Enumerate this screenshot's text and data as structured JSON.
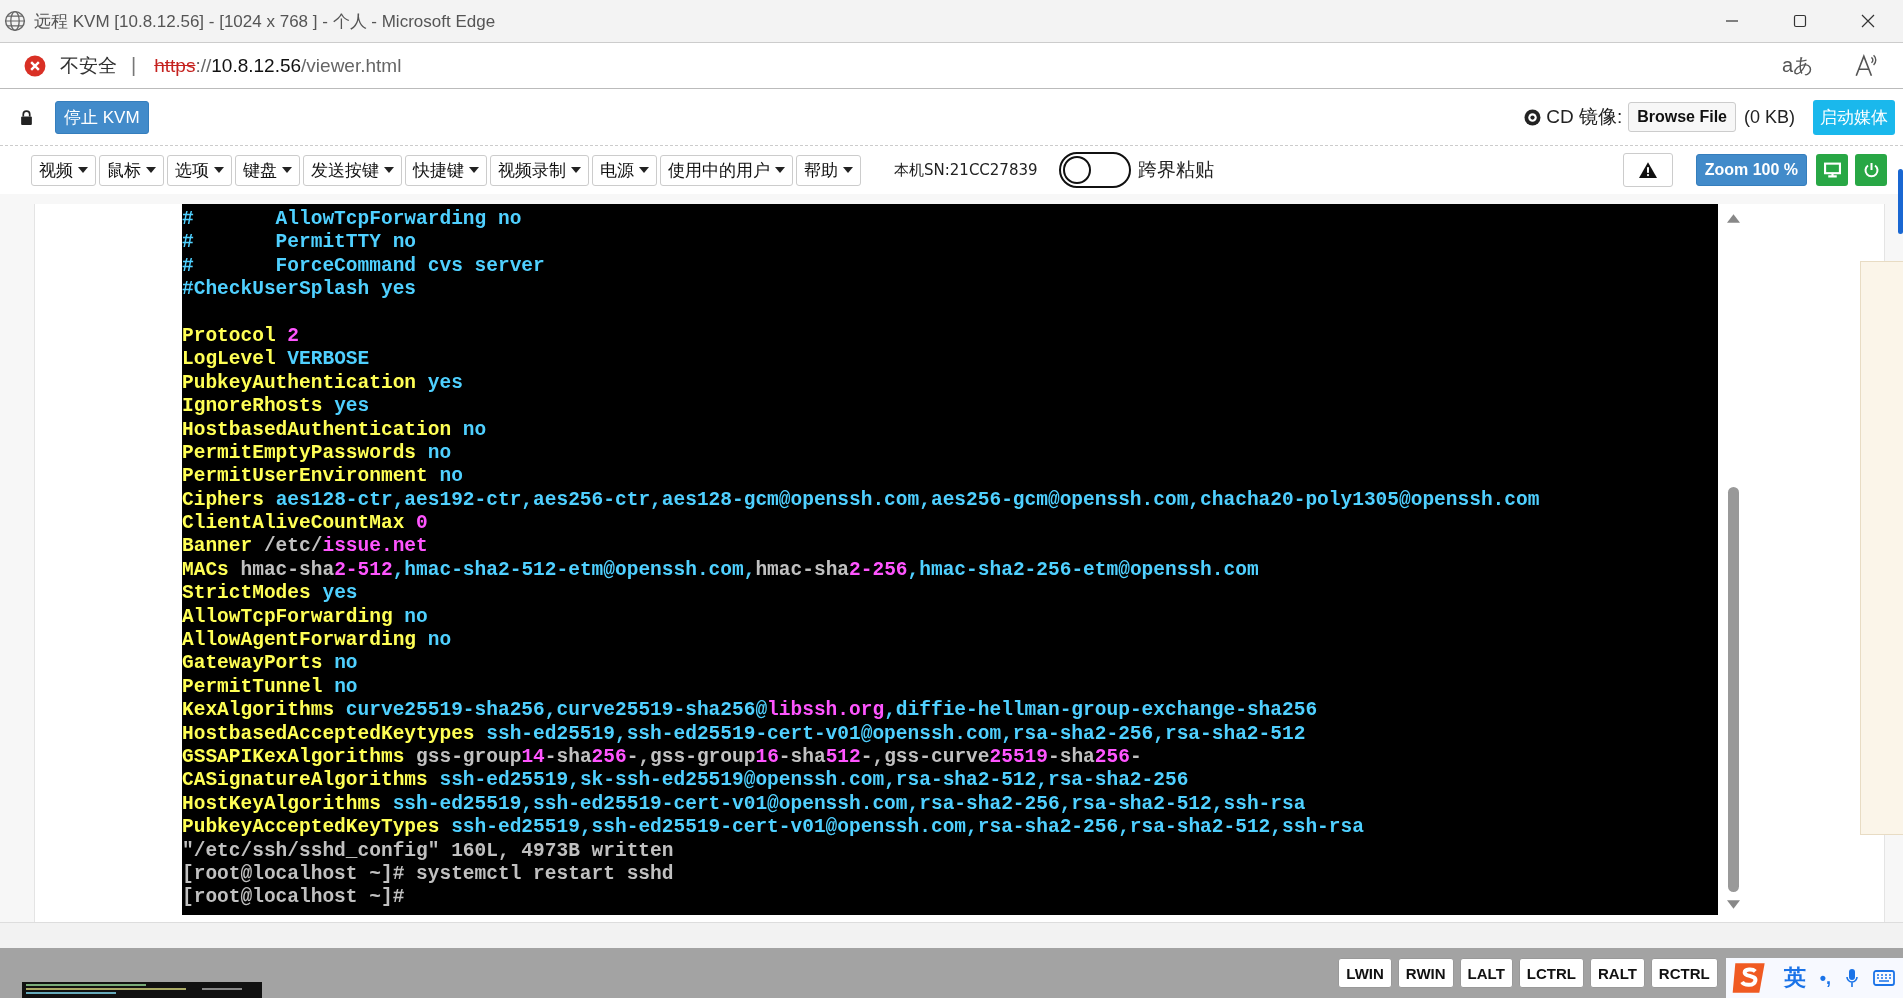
{
  "window": {
    "title": "远程 KVM [10.8.12.56] - [1024 x 768 ] - 个人 - Microsoft Edge"
  },
  "address_bar": {
    "security": "不安全",
    "separator": "|",
    "scheme": "https",
    "scheme_rest": "://",
    "host": "10.8.12.56",
    "path": "/viewer.html",
    "translate": "aあ"
  },
  "kvm_bar": {
    "stop_button": "停止 KVM",
    "cd_label": "CD 镜像:",
    "browse_button": "Browse File",
    "file_size": "(0 KB)",
    "start_media_button": "启动媒体"
  },
  "menus": [
    "视频",
    "鼠标",
    "选项",
    "键盘",
    "发送按键",
    "快捷键",
    "视频录制",
    "电源",
    "使用中的用户",
    "帮助"
  ],
  "serial": "本机SN:21CC27839",
  "paste_toggle": {
    "label": "跨界粘贴",
    "on": false
  },
  "zoom_button": "Zoom 100 %",
  "terminal": [
    {
      "segments": [
        {
          "text": "#       AllowTcpForwarding no",
          "color": "#4fd0ff"
        }
      ]
    },
    {
      "segments": [
        {
          "text": "#       PermitTTY no",
          "color": "#4fd0ff"
        }
      ]
    },
    {
      "segments": [
        {
          "text": "#       ForceCommand cvs server",
          "color": "#4fd0ff"
        }
      ]
    },
    {
      "segments": [
        {
          "text": "#CheckUserSplash yes",
          "color": "#4fd0ff"
        }
      ]
    },
    {
      "kind": "blank"
    },
    {
      "segments": [
        {
          "text": "Protocol ",
          "color": "#ffff55"
        },
        {
          "text": "2",
          "color": "#ff55ff"
        }
      ]
    },
    {
      "segments": [
        {
          "text": "LogLevel ",
          "color": "#ffff55"
        },
        {
          "text": "VERBOSE",
          "color": "#4fd0ff"
        }
      ]
    },
    {
      "segments": [
        {
          "text": "PubkeyAuthentication ",
          "color": "#ffff55"
        },
        {
          "text": "yes",
          "color": "#4fd0ff"
        }
      ]
    },
    {
      "segments": [
        {
          "text": "IgnoreRhosts ",
          "color": "#ffff55"
        },
        {
          "text": "yes",
          "color": "#4fd0ff"
        }
      ]
    },
    {
      "segments": [
        {
          "text": "HostbasedAuthentication ",
          "color": "#ffff55"
        },
        {
          "text": "no",
          "color": "#4fd0ff"
        }
      ]
    },
    {
      "segments": [
        {
          "text": "PermitEmptyPasswords ",
          "color": "#ffff55"
        },
        {
          "text": "no",
          "color": "#4fd0ff"
        }
      ]
    },
    {
      "segments": [
        {
          "text": "PermitUserEnvironment ",
          "color": "#ffff55"
        },
        {
          "text": "no",
          "color": "#4fd0ff"
        }
      ]
    },
    {
      "segments": [
        {
          "text": "Ciphers ",
          "color": "#ffff55"
        },
        {
          "text": "aes128-ctr,aes192-ctr,aes256-ctr,aes128-gcm@openssh.com,aes256-gcm@openssh.com,chacha20-poly1305@openssh.com",
          "color": "#4fd0ff"
        }
      ]
    },
    {
      "segments": [
        {
          "text": "ClientAliveCountMax ",
          "color": "#ffff55"
        },
        {
          "text": "0",
          "color": "#ff55ff"
        }
      ]
    },
    {
      "segments": [
        {
          "text": "Banner ",
          "color": "#ffff55"
        },
        {
          "text": "/etc/",
          "color": "#c0c0c0"
        },
        {
          "text": "issue.net",
          "color": "#ff55ff"
        }
      ]
    },
    {
      "segments": [
        {
          "text": "MACs ",
          "color": "#ffff55"
        },
        {
          "text": "hmac-sha",
          "color": "#c0c0c0"
        },
        {
          "text": "2-512",
          "color": "#ff55ff"
        },
        {
          "text": ",hmac-sha2-512-etm@openssh.com,",
          "color": "#4fd0ff"
        },
        {
          "text": "hmac-sha",
          "color": "#c0c0c0"
        },
        {
          "text": "2-256",
          "color": "#ff55ff"
        },
        {
          "text": ",hmac-sha2-256-etm@openssh.com",
          "color": "#4fd0ff"
        }
      ]
    },
    {
      "segments": [
        {
          "text": "StrictModes ",
          "color": "#ffff55"
        },
        {
          "text": "yes",
          "color": "#4fd0ff"
        }
      ]
    },
    {
      "segments": [
        {
          "text": "AllowTcpForwarding ",
          "color": "#ffff55"
        },
        {
          "text": "no",
          "color": "#4fd0ff"
        }
      ]
    },
    {
      "segments": [
        {
          "text": "AllowAgentForwarding ",
          "color": "#ffff55"
        },
        {
          "text": "no",
          "color": "#4fd0ff"
        }
      ]
    },
    {
      "segments": [
        {
          "text": "GatewayPorts ",
          "color": "#ffff55"
        },
        {
          "text": "no",
          "color": "#4fd0ff"
        }
      ]
    },
    {
      "segments": [
        {
          "text": "PermitTunnel ",
          "color": "#ffff55"
        },
        {
          "text": "no",
          "color": "#4fd0ff"
        }
      ]
    },
    {
      "segments": [
        {
          "text": "KexAlgorithms ",
          "color": "#ffff55"
        },
        {
          "text": "curve25519-sha256,curve25519-sha256@",
          "color": "#4fd0ff"
        },
        {
          "text": "libssh.org",
          "color": "#ff55ff"
        },
        {
          "text": ",diffie-hellman-group-exchange-sha256",
          "color": "#4fd0ff"
        }
      ]
    },
    {
      "segments": [
        {
          "text": "HostbasedAcceptedKeytypes ",
          "color": "#ffff55"
        },
        {
          "text": "ssh-ed25519,ssh-ed25519-cert-v01@openssh.com,rsa-sha2-256,rsa-sha2-512",
          "color": "#4fd0ff"
        }
      ]
    },
    {
      "segments": [
        {
          "text": "GSSAPIKexAlgorithms ",
          "color": "#ffff55"
        },
        {
          "text": "gss-group",
          "color": "#c0c0c0"
        },
        {
          "text": "14",
          "color": "#ff55ff"
        },
        {
          "text": "-sha",
          "color": "#c0c0c0"
        },
        {
          "text": "256",
          "color": "#ff55ff"
        },
        {
          "text": "-,gss-group",
          "color": "#c0c0c0"
        },
        {
          "text": "16",
          "color": "#ff55ff"
        },
        {
          "text": "-sha",
          "color": "#c0c0c0"
        },
        {
          "text": "512",
          "color": "#ff55ff"
        },
        {
          "text": "-,gss-curve",
          "color": "#c0c0c0"
        },
        {
          "text": "25519",
          "color": "#ff55ff"
        },
        {
          "text": "-sha",
          "color": "#c0c0c0"
        },
        {
          "text": "256",
          "color": "#ff55ff"
        },
        {
          "text": "-",
          "color": "#c0c0c0"
        }
      ]
    },
    {
      "segments": [
        {
          "text": "CASignatureAlgorithms ",
          "color": "#ffff55"
        },
        {
          "text": "ssh-ed25519,sk-ssh-ed25519@openssh.com,rsa-sha2-512,rsa-sha2-256",
          "color": "#4fd0ff"
        }
      ]
    },
    {
      "segments": [
        {
          "text": "HostKeyAlgorithms ",
          "color": "#ffff55"
        },
        {
          "text": "ssh-ed25519,ssh-ed25519-cert-v01@openssh.com,rsa-sha2-256,rsa-sha2-512,ssh-rsa",
          "color": "#4fd0ff"
        }
      ]
    },
    {
      "segments": [
        {
          "text": "PubkeyAcceptedKeyTypes ",
          "color": "#ffff55"
        },
        {
          "text": "ssh-ed25519,ssh-ed25519-cert-v01@openssh.com,rsa-sha2-256,rsa-sha2-512,ssh-rsa",
          "color": "#4fd0ff"
        }
      ]
    },
    {
      "segments": [
        {
          "text": "\"/etc/ssh/sshd_config\" 160L, 4973B written",
          "color": "#c0c0c0"
        }
      ]
    },
    {
      "segments": [
        {
          "text": "[root@localhost ~]# systemctl restart sshd",
          "color": "#c0c0c0"
        }
      ]
    },
    {
      "segments": [
        {
          "text": "[root@localhost ~]#",
          "color": "#c0c0c0"
        }
      ]
    }
  ],
  "keys": [
    "LWIN",
    "RWIN",
    "LALT",
    "LCTRL",
    "RALT",
    "RCTRL"
  ],
  "ime": {
    "language": "英",
    "punctuation": "•,"
  }
}
